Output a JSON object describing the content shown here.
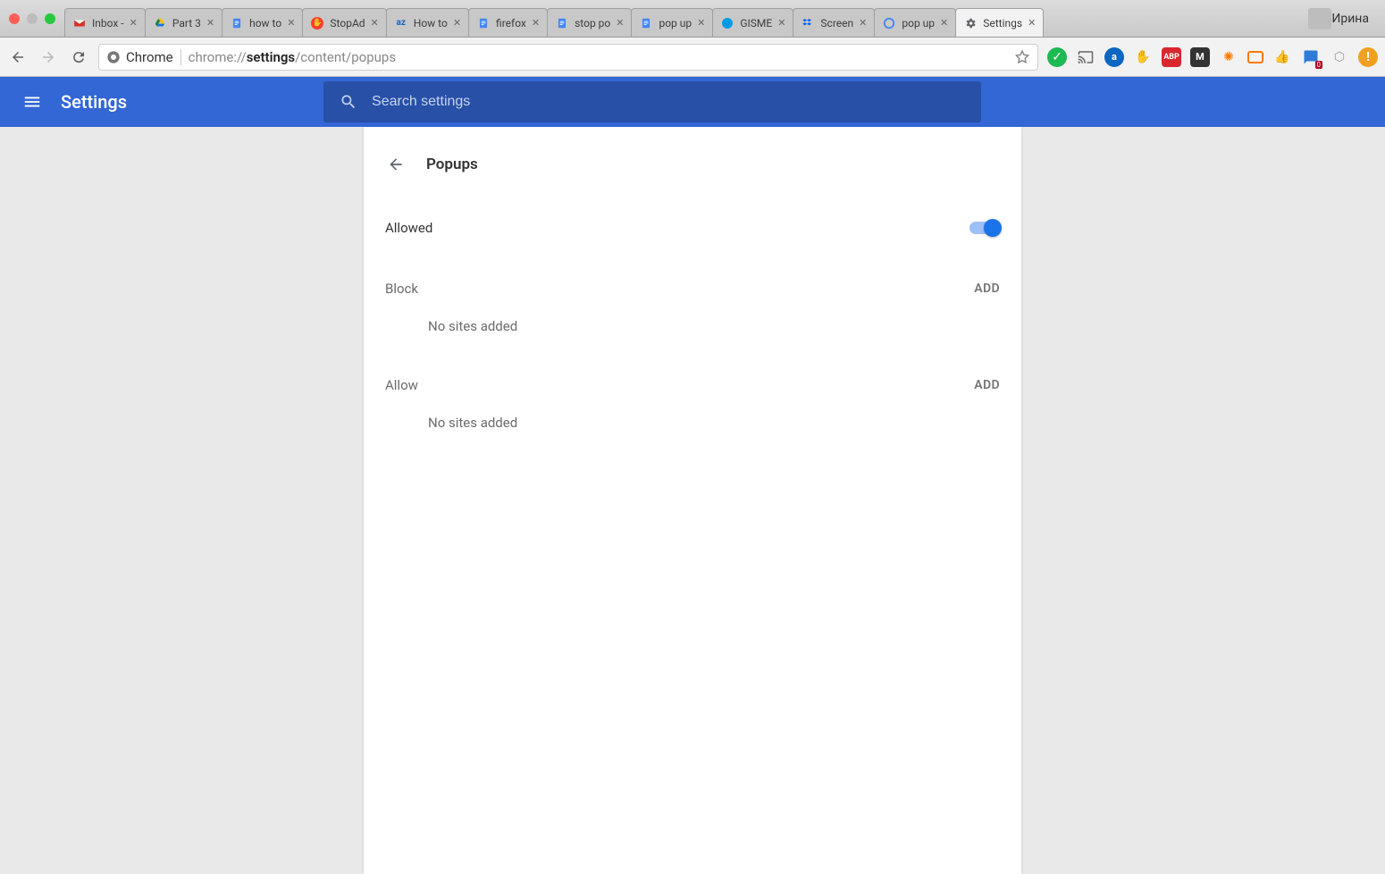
{
  "window": {
    "profile_name": "Ирина",
    "tabs": [
      {
        "label": "Inbox -",
        "icon": "gmail"
      },
      {
        "label": "Part 3",
        "icon": "drive"
      },
      {
        "label": "how to",
        "icon": "docs"
      },
      {
        "label": "StopAd",
        "icon": "stopad"
      },
      {
        "label": "How to",
        "icon": "az"
      },
      {
        "label": "firefox",
        "icon": "docs"
      },
      {
        "label": "stop po",
        "icon": "docs"
      },
      {
        "label": "pop up",
        "icon": "docs"
      },
      {
        "label": "GISME",
        "icon": "gisme"
      },
      {
        "label": "Screen",
        "icon": "dropbox"
      },
      {
        "label": "pop up",
        "icon": "google"
      },
      {
        "label": "Settings",
        "icon": "gear",
        "active": true
      }
    ]
  },
  "toolbar": {
    "secure_label": "Chrome",
    "url_prefix": "chrome://",
    "url_bold": "settings",
    "url_suffix": "/content/popups"
  },
  "header": {
    "title": "Settings",
    "search_placeholder": "Search settings"
  },
  "page": {
    "title": "Popups",
    "allowed_label": "Allowed",
    "allowed_on": true,
    "block": {
      "label": "Block",
      "add": "ADD",
      "empty": "No sites added"
    },
    "allow": {
      "label": "Allow",
      "add": "ADD",
      "empty": "No sites added"
    }
  }
}
